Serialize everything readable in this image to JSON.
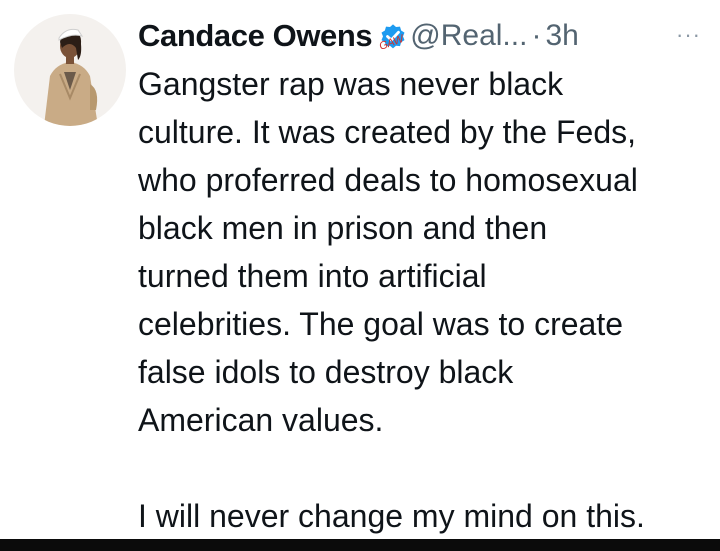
{
  "author": {
    "display_name": "Candace Owens",
    "handle": "@Real...",
    "separator": "·",
    "timestamp": "3h",
    "verified_badge_color": "#1d9bf0",
    "watermark": "GAW"
  },
  "menu": {
    "more_label": "···"
  },
  "tweet": {
    "lines": [
      "Gangster rap was never black",
      "culture. It was created by the Feds,",
      "who proferred deals to homosexual",
      "black men in prison and then",
      "turned them into artificial",
      "celebrities. The goal was to create",
      "false idols to destroy black",
      "American values.",
      "",
      "I will never change my mind on this."
    ]
  },
  "icons": {
    "avatar": "profile-photo",
    "verified": "verified-badge-icon",
    "more": "more-icon"
  }
}
